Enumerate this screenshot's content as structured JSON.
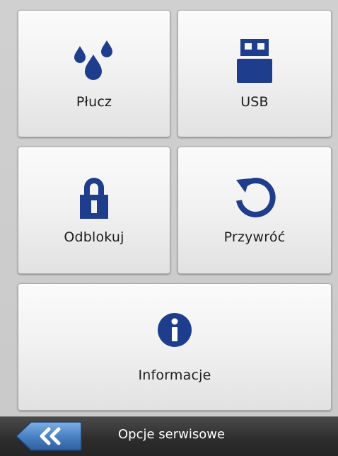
{
  "tiles": {
    "rinse": {
      "label": "Płucz",
      "icon": "water-drops-icon"
    },
    "usb": {
      "label": "USB",
      "icon": "usb-stick-icon"
    },
    "unlock": {
      "label": "Odblokuj",
      "icon": "padlock-icon"
    },
    "restore": {
      "label": "Przywróć",
      "icon": "restore-arrow-icon"
    },
    "info": {
      "label": "Informacje",
      "icon": "info-icon"
    }
  },
  "bottom_bar": {
    "back_icon": "double-chevron-left-icon",
    "title": "Opcje serwisowe"
  },
  "colors": {
    "icon_blue": "#1e3d8c",
    "back_button_blue": "#4a82c4",
    "bar_dark": "#2c2c2c",
    "background": "#cfcfcf"
  }
}
